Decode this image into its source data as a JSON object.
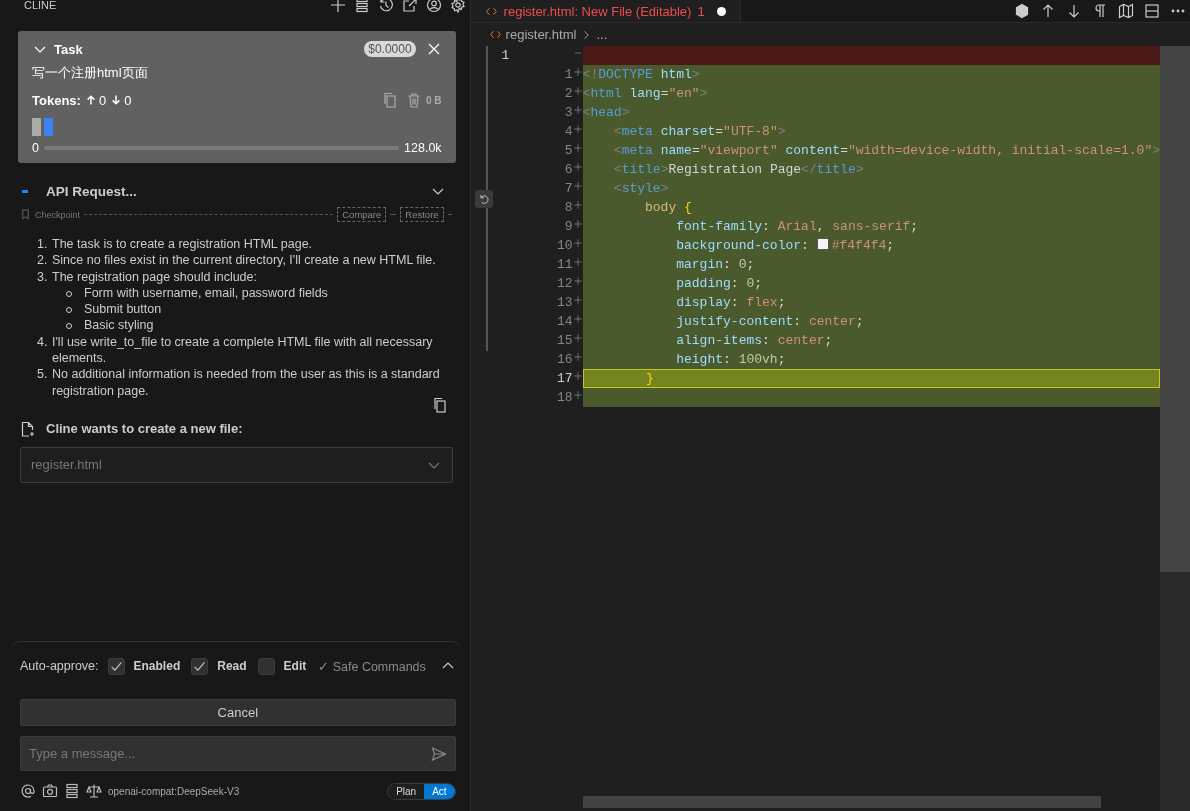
{
  "panel": {
    "title": "CLINE"
  },
  "task": {
    "title": "Task",
    "cost": "$0.0000",
    "text": "写一个注册html页面",
    "tokens_label": "Tokens:",
    "tokens_in": "0",
    "tokens_out": "0",
    "cache_size": "0 B",
    "context": {
      "min": "0",
      "max": "128.0k",
      "level": 0
    }
  },
  "api_request": {
    "title": "API Request..."
  },
  "checkpoint": {
    "label": "Checkpoint",
    "buttons": [
      "Compare",
      "Restore"
    ]
  },
  "response": {
    "items": [
      {
        "marker": "1.",
        "text": "The task is to create a registration HTML page."
      },
      {
        "marker": "2.",
        "text": "Since no files exist in the current directory, I'll create a new HTML file."
      },
      {
        "marker": "3.",
        "text": "The registration page should include:",
        "children": [
          {
            "text": "Form with username, email, password fields"
          },
          {
            "text": "Submit button"
          },
          {
            "text": "Basic styling"
          }
        ]
      },
      {
        "marker": "4.",
        "text": "I'll use write_to_file to create a complete HTML file with all necessary elements."
      },
      {
        "marker": "5.",
        "text": "No additional information is needed from the user as this is a standard registration page."
      }
    ]
  },
  "file_request": {
    "title": "Cline wants to create a new file:",
    "file": "register.html"
  },
  "auto_approve": {
    "label": "Auto-approve:",
    "options": [
      {
        "label": "Enabled",
        "checked": true
      },
      {
        "label": "Read",
        "checked": true
      },
      {
        "label": "Edit",
        "checked": false
      }
    ],
    "safe_commands": "✓ Safe Commands"
  },
  "cancel_button": "Cancel",
  "message": {
    "placeholder": "Type a message..."
  },
  "model": "openai-compat:DeepSeek-V3",
  "modes": [
    {
      "label": "Plan",
      "selected": false
    },
    {
      "label": "Act",
      "selected": true
    }
  ],
  "editor": {
    "tab": {
      "title": "register.html: New File (Editable)",
      "problems": "1",
      "modified": true
    },
    "breadcrumb": {
      "file": "register.html",
      "rest": "..."
    },
    "deleted_line": {
      "number": "1"
    },
    "lines": [
      {
        "number": "1",
        "current": false,
        "text": "<!DOCTYPE html>"
      },
      {
        "number": "2",
        "current": false,
        "text": "<html lang=\"en\">"
      },
      {
        "number": "3",
        "current": false,
        "text": "<head>"
      },
      {
        "number": "4",
        "current": false,
        "text": "    <meta charset=\"UTF-8\">"
      },
      {
        "number": "5",
        "current": false,
        "text": "    <meta name=\"viewport\" content=\"width=device-width, initial-scale=1.0\">"
      },
      {
        "number": "6",
        "current": false,
        "text": "    <title>Registration Page</title>"
      },
      {
        "number": "7",
        "current": false,
        "text": "    <style>"
      },
      {
        "number": "8",
        "current": false,
        "text": "        body {"
      },
      {
        "number": "9",
        "current": false,
        "text": "            font-family: Arial, sans-serif;"
      },
      {
        "number": "10",
        "current": false,
        "text": "            background-color: #f4f4f4;"
      },
      {
        "number": "11",
        "current": false,
        "text": "            margin: 0;"
      },
      {
        "number": "12",
        "current": false,
        "text": "            padding: 0;"
      },
      {
        "number": "13",
        "current": false,
        "text": "            display: flex;"
      },
      {
        "number": "14",
        "current": false,
        "text": "            justify-content: center;"
      },
      {
        "number": "15",
        "current": false,
        "text": "            align-items: center;"
      },
      {
        "number": "16",
        "current": false,
        "text": "            height: 100vh;"
      },
      {
        "number": "17",
        "current": true,
        "text": "        }"
      },
      {
        "number": "18",
        "current": false
      }
    ]
  }
}
